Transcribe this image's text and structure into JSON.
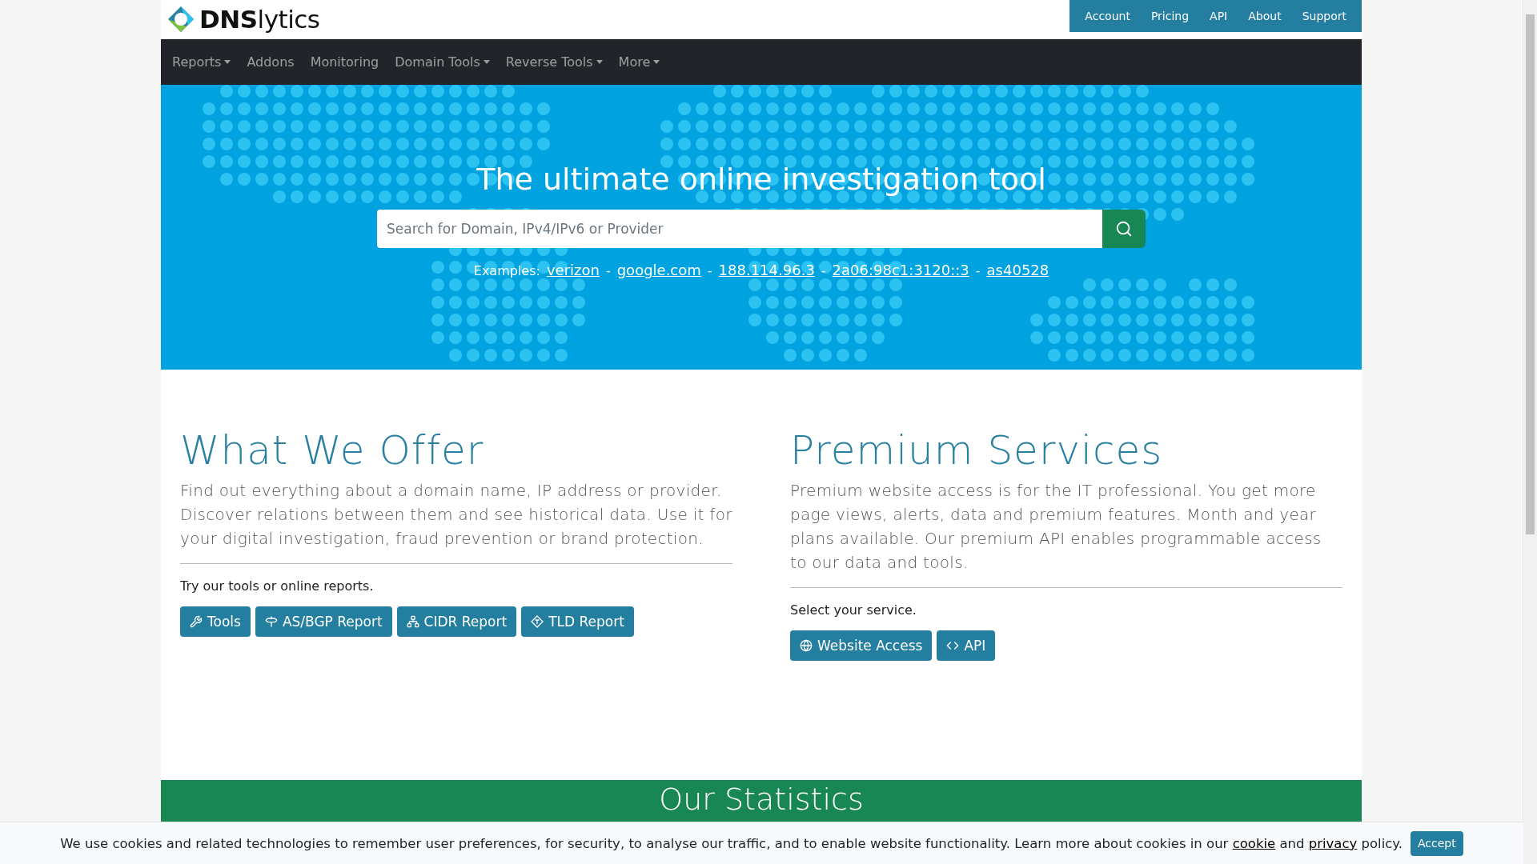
{
  "logo": {
    "bold": "DNS",
    "rest": "lytics"
  },
  "top_nav": [
    "Account",
    "Pricing",
    "API",
    "About",
    "Support"
  ],
  "main_nav": [
    {
      "label": "Reports",
      "dropdown": true
    },
    {
      "label": "Addons",
      "dropdown": false
    },
    {
      "label": "Monitoring",
      "dropdown": false
    },
    {
      "label": "Domain Tools",
      "dropdown": true
    },
    {
      "label": "Reverse Tools",
      "dropdown": true
    },
    {
      "label": "More",
      "dropdown": true
    }
  ],
  "hero": {
    "title": "The ultimate online investigation tool",
    "search": {
      "placeholder": "Search for Domain, IPv4/IPv6 or Provider"
    },
    "examples": [
      {
        "kind": "label",
        "text": "Examples:"
      },
      {
        "kind": "link",
        "text": "verizon"
      },
      {
        "kind": "sep",
        "text": "-"
      },
      {
        "kind": "link",
        "text": "google.com"
      },
      {
        "kind": "sep",
        "text": "-"
      },
      {
        "kind": "link",
        "text": "188.114.96.3"
      },
      {
        "kind": "sep",
        "text": "-"
      },
      {
        "kind": "link",
        "text": "2a06:98c1:3120::3"
      },
      {
        "kind": "sep",
        "text": "-"
      },
      {
        "kind": "link",
        "text": "as40528"
      }
    ]
  },
  "sections": [
    {
      "title": "What We Offer",
      "body": "Find out everything about a domain name, IP address or provider. Discover relations between them and see historical data. Use it for your digital investigation, fraud prevention or brand protection.",
      "lead": "Try our tools or online reports.",
      "buttons": [
        {
          "label": "Tools"
        },
        {
          "label": "AS/BGP Report"
        },
        {
          "label": "CIDR Report"
        },
        {
          "label": "TLD Report"
        }
      ]
    },
    {
      "title": "Premium Services",
      "body": "Premium website access is for the IT professional. You get more page views, alerts, data and premium features. Month and year plans available. Our premium API enables programmable access to our data and tools.",
      "lead": "Select your service.",
      "buttons": [
        {
          "label": "Website Access"
        },
        {
          "label": "API"
        }
      ]
    }
  ],
  "stats": {
    "title": "Our Statistics"
  },
  "cookie_bar": {
    "text": "We use cookies and related technologies to remember user preferences, for security, to analyse our traffic, and to enable website functionality. Learn more about cookies in our",
    "link_1": "cookie",
    "middle": "and",
    "link_2": "privacy",
    "end": "policy.",
    "button": "Accept"
  }
}
